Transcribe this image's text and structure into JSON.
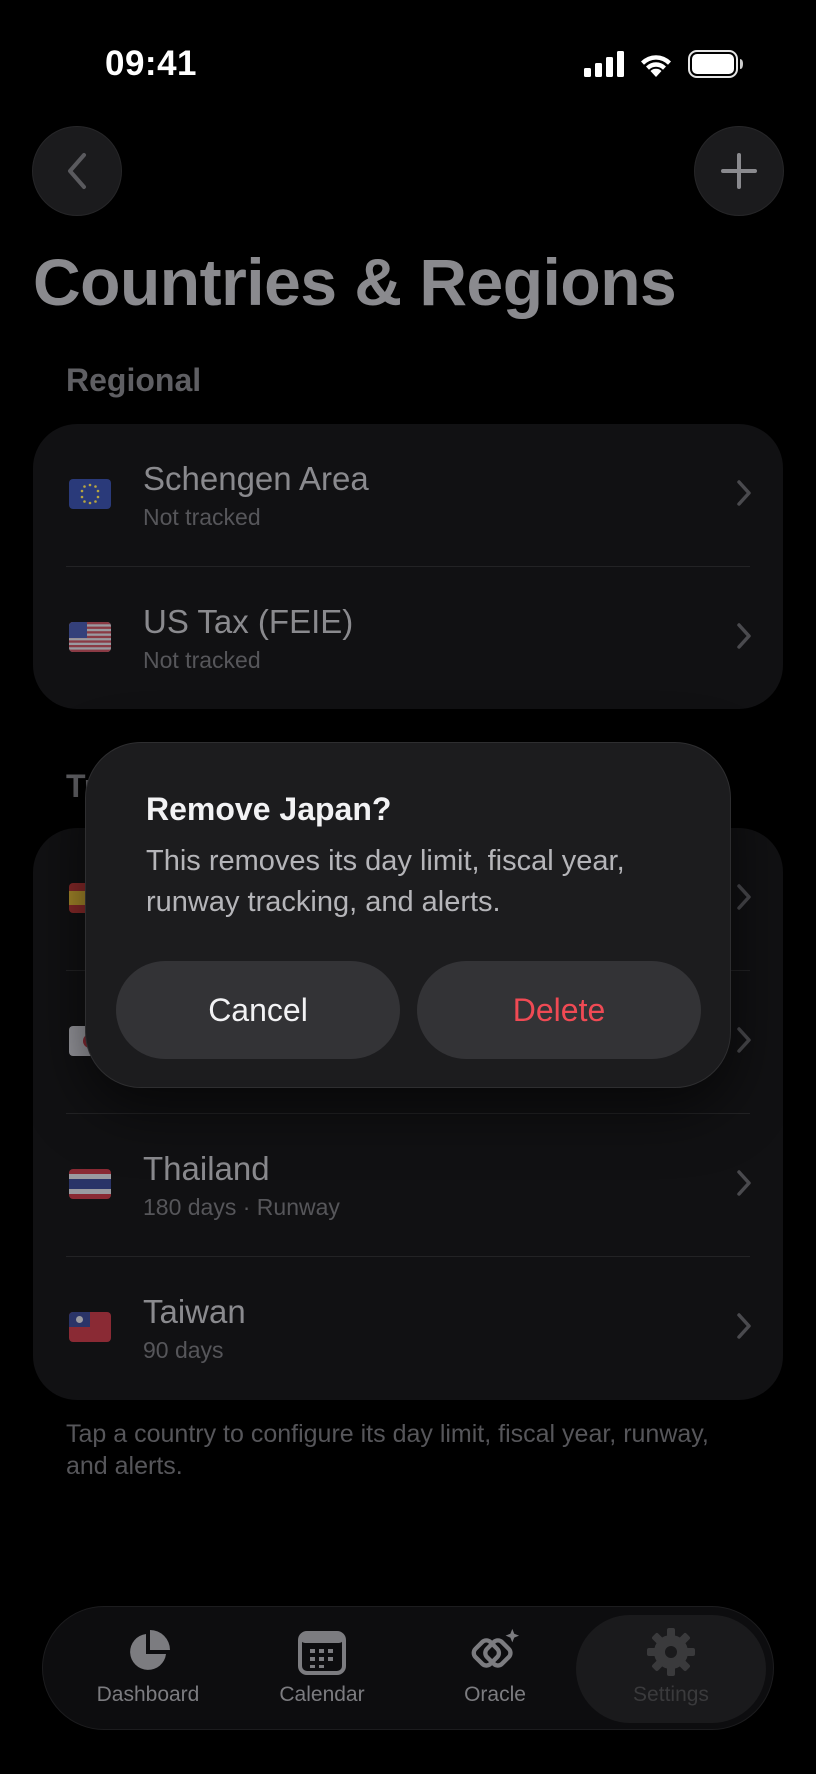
{
  "status_bar": {
    "time": "09:41"
  },
  "page": {
    "title": "Countries & Regions"
  },
  "sections": {
    "regional": {
      "header": "Regional",
      "rows": [
        {
          "title": "Schengen Area",
          "subtitle": "Not tracked",
          "flag": "eu-flag"
        },
        {
          "title": "US Tax (FEIE)",
          "subtitle": "Not tracked",
          "flag": "us-flag"
        }
      ]
    },
    "tracked": {
      "header": "Tracked",
      "rows": [
        {
          "title": "",
          "subtitle": "",
          "flag": "es-flag"
        },
        {
          "title": "",
          "subtitle": "",
          "flag": "jp-flag"
        },
        {
          "title": "Thailand",
          "subtitle": "180 days · Runway",
          "flag": "th-flag"
        },
        {
          "title": "Taiwan",
          "subtitle": "90 days",
          "flag": "tw-flag"
        }
      ]
    }
  },
  "footnote": "Tap a country to configure its day limit, fiscal year, runway, and alerts.",
  "dialog": {
    "title": "Remove Japan?",
    "message": "This removes its day limit, fiscal year, runway tracking, and alerts.",
    "cancel_label": "Cancel",
    "delete_label": "Delete"
  },
  "tab_bar": {
    "tabs": [
      {
        "label": "Dashboard",
        "icon": "pie-chart-icon"
      },
      {
        "label": "Calendar",
        "icon": "calendar-icon"
      },
      {
        "label": "Oracle",
        "icon": "oracle-icon"
      },
      {
        "label": "Settings",
        "icon": "gear-icon"
      }
    ],
    "selected": "Settings"
  },
  "colors": {
    "background": "#000000",
    "card": "#111113",
    "dialog": "#1c1c1e",
    "destructive": "#f04a54",
    "muted_text": "#8a8a8e"
  }
}
